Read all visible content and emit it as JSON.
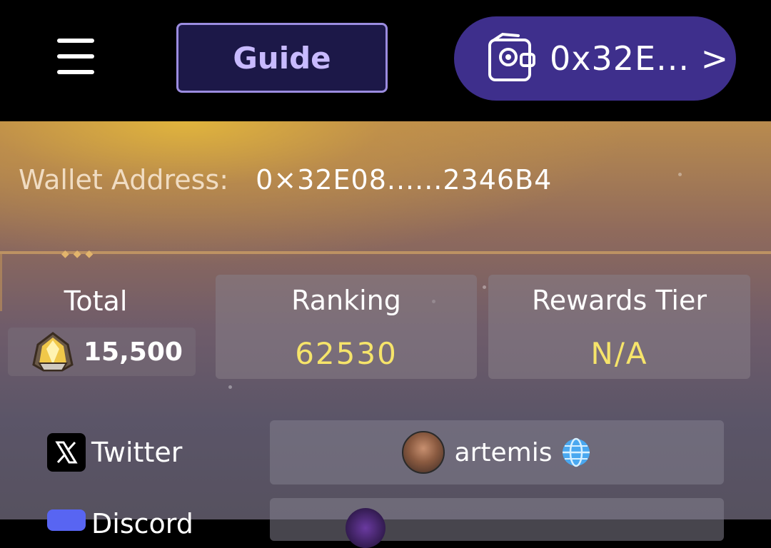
{
  "header": {
    "guide_label": "Guide",
    "wallet_button_label": "0x32E... >"
  },
  "profile": {
    "wallet_address_label": "Wallet Address:",
    "wallet_address_value": "0×32E08......2346B4"
  },
  "stats": {
    "total_label": "Total",
    "total_value": "15,500",
    "ranking_label": "Ranking",
    "ranking_value": "62530",
    "tier_label": "Rewards Tier",
    "tier_value": "N/A"
  },
  "socials": [
    {
      "platform": "Twitter",
      "username": "artemis"
    },
    {
      "platform": "Discord",
      "username": ""
    }
  ],
  "colors": {
    "accent_purple": "#3e2f8c",
    "guide_text": "#c8baff",
    "value_yellow": "#f6e46a"
  }
}
